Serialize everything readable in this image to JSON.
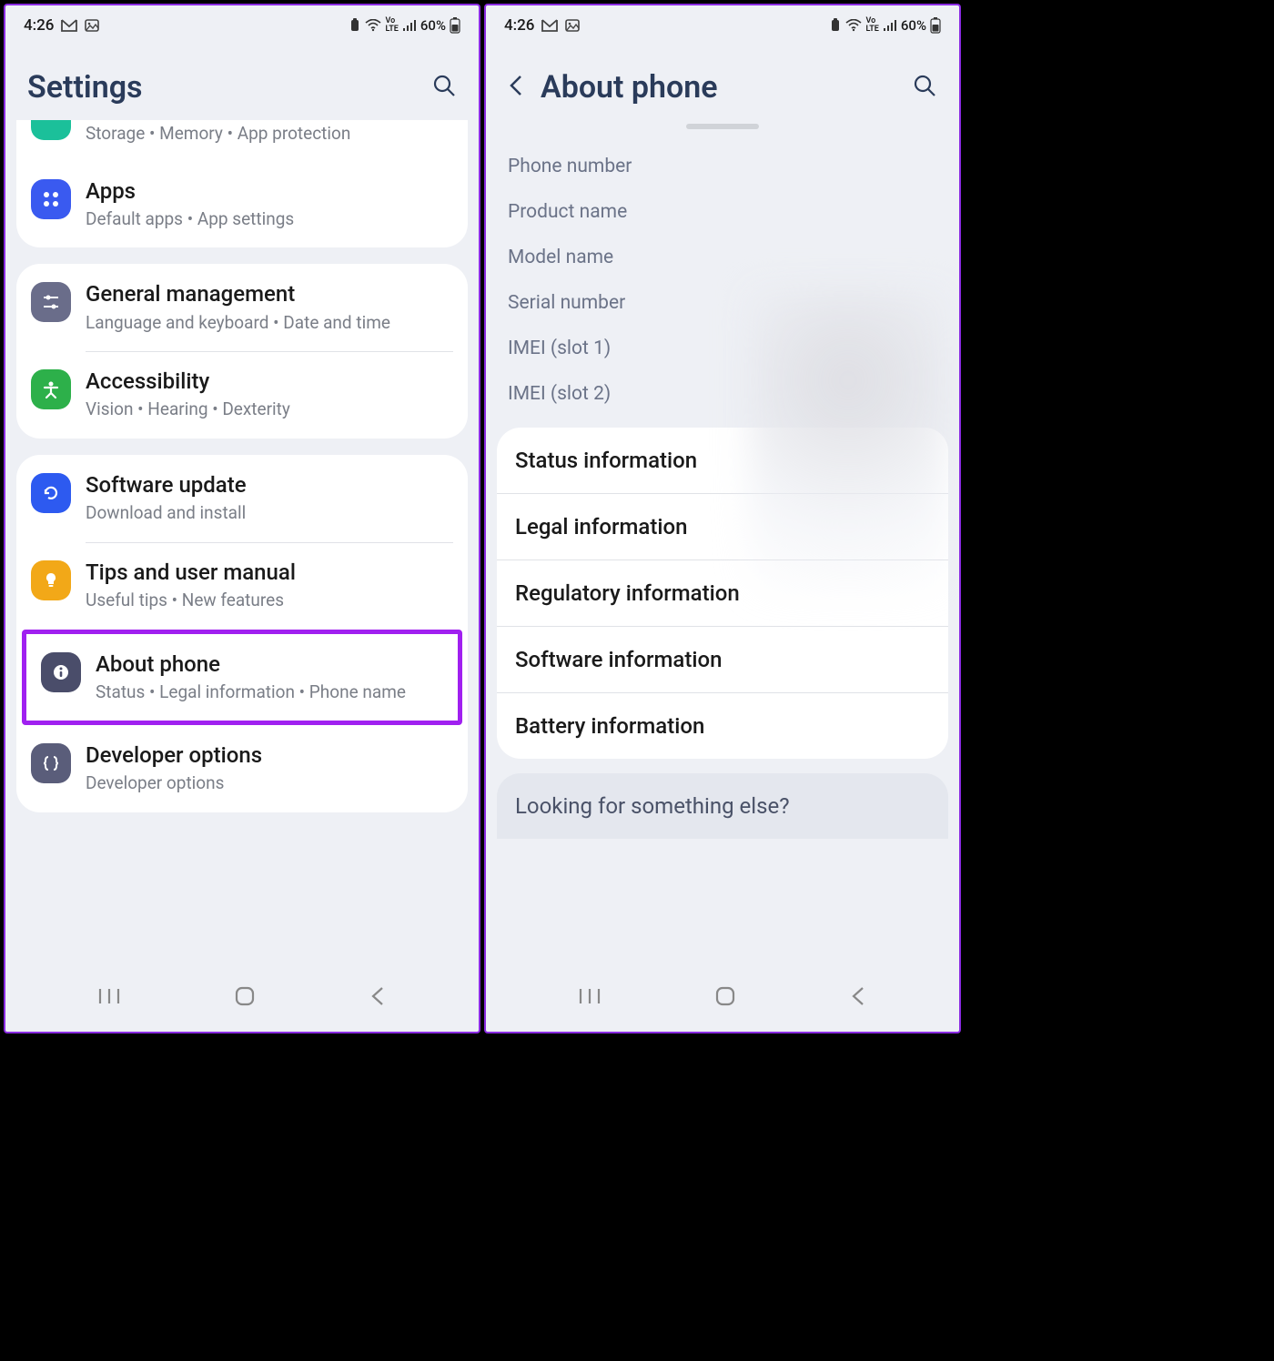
{
  "status": {
    "time": "4:26",
    "battery": "60%",
    "volte": "Vo LTE"
  },
  "left": {
    "title": "Settings",
    "partial_sub": "Storage  •  Memory  •  App protection",
    "groups": [
      {
        "items": [
          {
            "title": "Apps",
            "sub": "Default apps  •  App settings",
            "icon_bg": "#3a5af0",
            "icon": "apps"
          }
        ]
      },
      {
        "items": [
          {
            "title": "General management",
            "sub": "Language and keyboard  •  Date and time",
            "icon_bg": "#6a6d8a",
            "icon": "sliders"
          },
          {
            "title": "Accessibility",
            "sub": "Vision  •  Hearing  •  Dexterity",
            "icon_bg": "#2db04a",
            "icon": "person"
          }
        ]
      },
      {
        "items": [
          {
            "title": "Software update",
            "sub": "Download and install",
            "icon_bg": "#2d5af0",
            "icon": "refresh"
          },
          {
            "title": "Tips and user manual",
            "sub": "Useful tips  •  New features",
            "icon_bg": "#f2a818",
            "icon": "bulb"
          },
          {
            "title": "About phone",
            "sub": "Status  •  Legal information  •  Phone name",
            "icon_bg": "#4a4d6a",
            "icon": "info",
            "highlight": true
          },
          {
            "title": "Developer options",
            "sub": "Developer options",
            "icon_bg": "#5a5d7a",
            "icon": "braces"
          }
        ]
      }
    ]
  },
  "right": {
    "title": "About phone",
    "info_labels": [
      "Phone number",
      "Product name",
      "Model name",
      "Serial number",
      "IMEI (slot 1)",
      "IMEI (slot 2)"
    ],
    "links": [
      "Status information",
      "Legal information",
      "Regulatory information",
      "Software information",
      "Battery information"
    ],
    "footer": "Looking for something else?"
  }
}
